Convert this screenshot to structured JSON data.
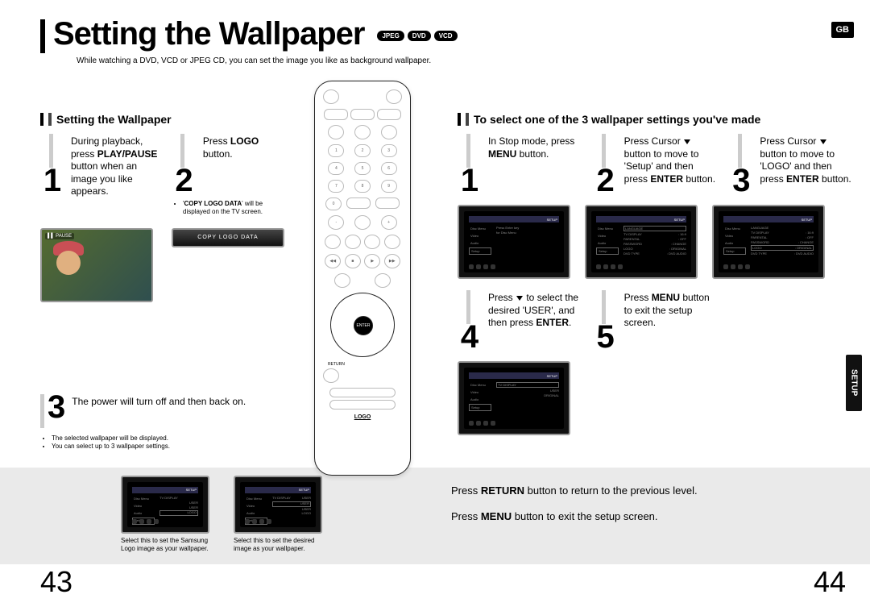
{
  "badge": "GB",
  "title": "Setting the Wallpaper",
  "title_tags": [
    "JPEG",
    "DVD",
    "VCD"
  ],
  "subtitle": "While watching a DVD, VCD or JPEG CD, you can set the image you like as background wallpaper.",
  "setup_tab": "SETUP",
  "left": {
    "heading": "Setting the Wallpaper",
    "step1": {
      "num": "1",
      "pre": "During playback, press ",
      "bold": "PLAY/PAUSE",
      "post": " button when an image you like appears."
    },
    "step2": {
      "num": "2",
      "pre": "Press ",
      "bold": "LOGO",
      "post": " button."
    },
    "step2_note_pre": "'",
    "step2_note_bold": "COPY LOGO DATA",
    "step2_note_post": "' will be displayed on the TV screen.",
    "step2_logo": "COPY LOGO DATA",
    "pause_tag": "▌▌ PAUSE",
    "step3": {
      "num": "3",
      "text": "The power will turn off and then back on."
    },
    "step3_notes": [
      "The selected wallpaper will be displayed.",
      "You can select up to 3 wallpaper settings."
    ]
  },
  "right": {
    "heading": "To select one of the 3 wallpaper settings you've made",
    "step1": {
      "num": "1",
      "pre": "In Stop mode, press ",
      "bold": "MENU",
      "post": " button."
    },
    "step2": {
      "num": "2",
      "pre": "Press Cursor ",
      "mid": " button to move to 'Setup' and then press ",
      "bold": "ENTER",
      "post": " button."
    },
    "step3": {
      "num": "3",
      "pre": "Press Cursor ",
      "mid": " button to move to 'LOGO' and then press ",
      "bold": "ENTER",
      "post": " button."
    },
    "step4": {
      "num": "4",
      "pre": "Press ",
      "mid": " to select the desired 'USER', and then press ",
      "bold": "ENTER",
      "post": "."
    },
    "step5": {
      "num": "5",
      "pre": "Press ",
      "bold": "MENU",
      "post": " button to exit the setup screen."
    }
  },
  "screens": {
    "top_label": "SETUP",
    "side_items": [
      "Disc Menu",
      "Video",
      "Audio",
      "Setup"
    ],
    "msg1": "Press Enter key",
    "msg2": "for Disc Menu",
    "setup_items": [
      {
        "k": "LANGUAGE",
        "v": ""
      },
      {
        "k": "TV DISPLAY",
        "v": ": 16:9"
      },
      {
        "k": "PARENTAL",
        "v": ": OFF"
      },
      {
        "k": "PASSWORD",
        "v": ": CHANGE"
      },
      {
        "k": "LOGO",
        "v": ": ORIGINAL"
      },
      {
        "k": "DVD TYPE",
        "v": ": DVD AUDIO"
      }
    ],
    "logo_items": [
      {
        "k": "TV DISPLAY",
        "v": ""
      },
      {
        "k": "",
        "v": "USER"
      },
      {
        "k": "",
        "v": "ORIGINAL"
      }
    ],
    "bottom_user": [
      {
        "k": "TV DISPLAY",
        "v": "USER"
      },
      {
        "k": "",
        "v": "USER"
      },
      {
        "k": "",
        "v": "USER"
      },
      {
        "k": "",
        "v": "LOGO"
      }
    ]
  },
  "remote": {
    "enter": "ENTER",
    "return": "RETURN",
    "logo": "LOGO"
  },
  "bottom": {
    "cap1": "Select this to set the Samsung Logo image as your wallpaper.",
    "cap2": "Select this to set the desired image as your wallpaper.",
    "note1_pre": "Press ",
    "note1_bold": "RETURN",
    "note1_post": " button to return to the previous level.",
    "note2_pre": "Press ",
    "note2_bold": "MENU",
    "note2_post": " button to exit the setup screen."
  },
  "pages": {
    "left": "43",
    "right": "44"
  }
}
